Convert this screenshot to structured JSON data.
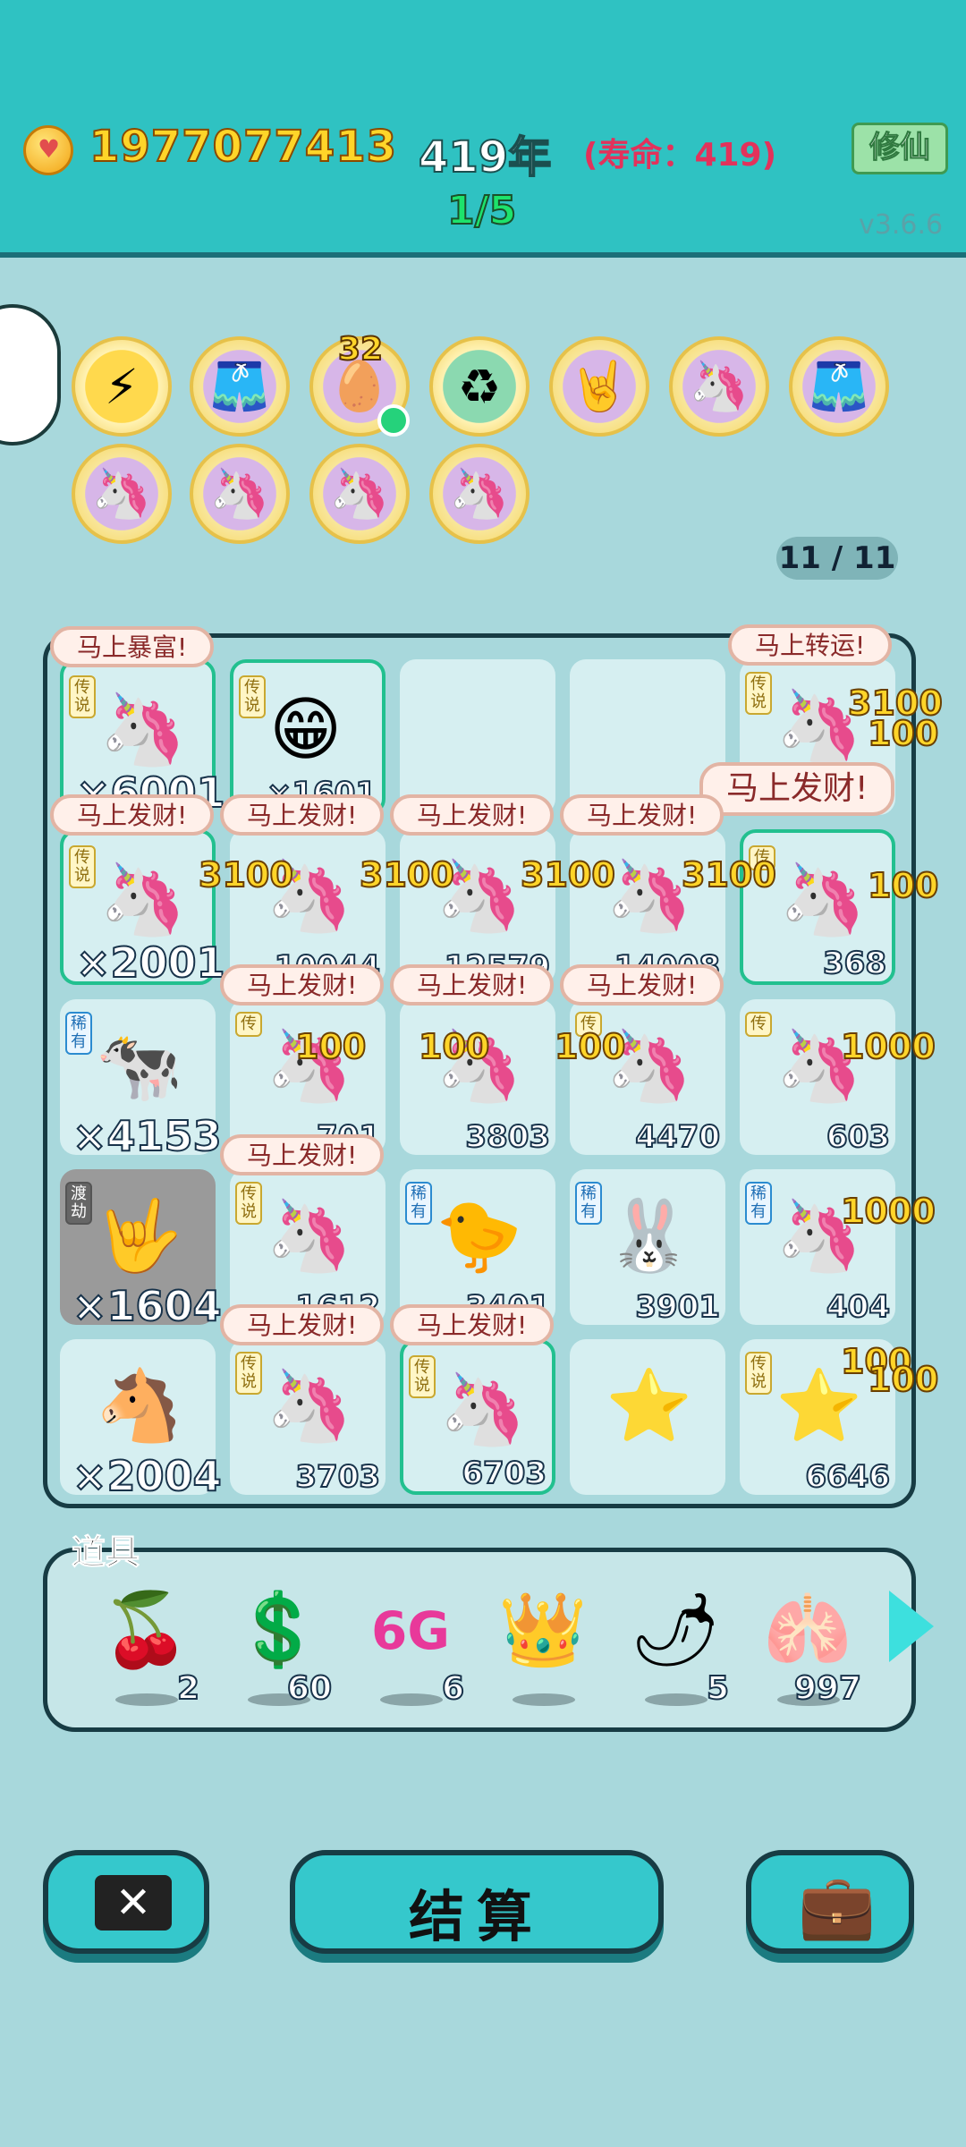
{
  "header": {
    "coins": "1977077413",
    "years": "419年",
    "lifespan": "(寿命：419)",
    "progress": "1/5",
    "xiuxian_label": "修仙",
    "version": "v3.6.6"
  },
  "skills": [
    {
      "icon": "lightning-icon",
      "glyph": "⚡"
    },
    {
      "icon": "skirt-icon",
      "glyph": "🩳"
    },
    {
      "icon": "egg-tray-icon",
      "glyph": "🥚",
      "count": "32"
    },
    {
      "icon": "recycle-icon",
      "glyph": "♻"
    },
    {
      "icon": "rock-hand-icon",
      "glyph": "🤘"
    },
    {
      "icon": "unicorn-icon",
      "glyph": "🦄"
    },
    {
      "icon": "skirt-icon",
      "glyph": "🩳"
    },
    {
      "icon": "unicorn-icon",
      "glyph": "🦄"
    },
    {
      "icon": "unicorn-icon",
      "glyph": "🦄"
    },
    {
      "icon": "unicorn-icon",
      "glyph": "🦄"
    },
    {
      "icon": "unicorn-icon",
      "glyph": "🦄"
    }
  ],
  "pager": "11 / 11",
  "board": {
    "bubbles": {
      "rich_now": "马上暴富!",
      "luck_now": "马上转运!",
      "fortune": "马上发财!"
    },
    "cells": [
      {
        "tag": "传说",
        "glyph": "🦄",
        "count": "×6001",
        "big": true
      },
      {
        "tag": "传说",
        "glyph": "😁",
        "count": "×1601"
      },
      {
        "tag": "",
        "glyph": "",
        "count": ""
      },
      {
        "tag": "",
        "glyph": "",
        "count": ""
      },
      {
        "tag": "传说",
        "glyph": "🦄",
        "count": "3100"
      },
      {
        "tag": "传说",
        "glyph": "🦄",
        "count": "×2001",
        "big": true
      },
      {
        "tag": "",
        "glyph": "🦄",
        "count": "10044"
      },
      {
        "tag": "",
        "glyph": "🦄",
        "count": "12579"
      },
      {
        "tag": "",
        "glyph": "🦄",
        "count": "14008"
      },
      {
        "tag": "传",
        "glyph": "🦄",
        "count": "368"
      },
      {
        "tag": "稀有",
        "glyph": "🐄",
        "count": "×4153",
        "big": true
      },
      {
        "tag": "传",
        "glyph": "🦄",
        "count": "701"
      },
      {
        "tag": "",
        "glyph": "🦄",
        "count": "3803"
      },
      {
        "tag": "传",
        "glyph": "🦄",
        "count": "4470"
      },
      {
        "tag": "传",
        "glyph": "🦄",
        "count": "603"
      },
      {
        "tag": "渡劫",
        "glyph": "🤟",
        "count": "×1604",
        "big": true
      },
      {
        "tag": "传说",
        "glyph": "🦄",
        "count": "1612"
      },
      {
        "tag": "稀有",
        "glyph": "🐤",
        "count": "3401"
      },
      {
        "tag": "稀有",
        "glyph": "🐰",
        "count": "3901"
      },
      {
        "tag": "稀有",
        "glyph": "🦄",
        "count": "404"
      },
      {
        "tag": "",
        "glyph": "🐴",
        "count": "×2004",
        "big": true
      },
      {
        "tag": "传说",
        "glyph": "🦄",
        "count": "3703"
      },
      {
        "tag": "传说",
        "glyph": "🦄",
        "count": "6703"
      },
      {
        "tag": "",
        "glyph": "⭐",
        "count": ""
      },
      {
        "tag": "传说",
        "glyph": "⭐",
        "count": "6646"
      }
    ],
    "floating_numbers": [
      "3100",
      "100",
      "3100",
      "3100",
      "3100",
      "3100",
      "100",
      "100",
      "100",
      "100",
      "1000",
      "1000",
      "100",
      "100"
    ]
  },
  "items_label": "道具",
  "items": [
    {
      "icon": "lychee-icon",
      "glyph": "🍒",
      "count": "2"
    },
    {
      "icon": "dollar-coin-icon",
      "glyph": "💲",
      "count": "60"
    },
    {
      "icon": "6g-icon",
      "glyph": "6G",
      "count": "6"
    },
    {
      "icon": "crown-icon",
      "glyph": "👑",
      "count": ""
    },
    {
      "icon": "chili-icon",
      "glyph": "🌶",
      "count": "5"
    },
    {
      "icon": "liver-icon",
      "glyph": "🫁",
      "count": "997"
    }
  ],
  "buttons": {
    "close_glyph": "✕",
    "settle_label": "结算",
    "bag_glyph": "💼"
  }
}
